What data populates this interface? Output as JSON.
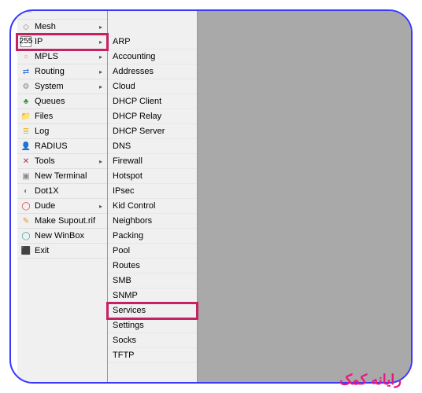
{
  "sidebar": {
    "items": [
      {
        "icon": "──",
        "iconClass": "c-gray",
        "label": "",
        "hasSub": false
      },
      {
        "icon": "◇",
        "iconClass": "c-gray",
        "label": "Mesh",
        "hasSub": true
      },
      {
        "icon": "255",
        "iconClass": "ip-box",
        "label": "IP",
        "hasSub": true,
        "highlight": true
      },
      {
        "icon": "○",
        "iconClass": "c-orange",
        "label": "MPLS",
        "hasSub": true
      },
      {
        "icon": "⇄",
        "iconClass": "c-blue",
        "label": "Routing",
        "hasSub": true
      },
      {
        "icon": "⚙",
        "iconClass": "c-gray",
        "label": "System",
        "hasSub": true
      },
      {
        "icon": "♣",
        "iconClass": "c-green",
        "label": "Queues",
        "hasSub": false
      },
      {
        "icon": "📁",
        "iconClass": "c-blue",
        "label": "Files",
        "hasSub": false
      },
      {
        "icon": "≣",
        "iconClass": "c-yellow",
        "label": "Log",
        "hasSub": false
      },
      {
        "icon": "👤",
        "iconClass": "c-green",
        "label": "RADIUS",
        "hasSub": false
      },
      {
        "icon": "✕",
        "iconClass": "c-crimson",
        "label": "Tools",
        "hasSub": true
      },
      {
        "icon": "▣",
        "iconClass": "c-gray",
        "label": "New Terminal",
        "hasSub": false
      },
      {
        "icon": "◐",
        "iconClass": "c-gray",
        "label": "Dot1X",
        "hasSub": false
      },
      {
        "icon": "◯",
        "iconClass": "c-red",
        "label": "Dude",
        "hasSub": true
      },
      {
        "icon": "✎",
        "iconClass": "c-orange",
        "label": "Make Supout.rif",
        "hasSub": false
      },
      {
        "icon": "◯",
        "iconClass": "c-teal",
        "label": "New WinBox",
        "hasSub": false
      },
      {
        "icon": "⬛",
        "iconClass": "c-brown",
        "label": "Exit",
        "hasSub": false
      }
    ]
  },
  "submenu": {
    "items": [
      {
        "label": "ARP"
      },
      {
        "label": "Accounting"
      },
      {
        "label": "Addresses"
      },
      {
        "label": "Cloud"
      },
      {
        "label": "DHCP Client"
      },
      {
        "label": "DHCP Relay"
      },
      {
        "label": "DHCP Server"
      },
      {
        "label": "DNS"
      },
      {
        "label": "Firewall"
      },
      {
        "label": "Hotspot"
      },
      {
        "label": "IPsec"
      },
      {
        "label": "Kid Control"
      },
      {
        "label": "Neighbors"
      },
      {
        "label": "Packing"
      },
      {
        "label": "Pool"
      },
      {
        "label": "Routes"
      },
      {
        "label": "SMB"
      },
      {
        "label": "SNMP"
      },
      {
        "label": "Services",
        "highlight": true
      },
      {
        "label": "Settings"
      },
      {
        "label": "Socks"
      },
      {
        "label": "TFTP"
      }
    ]
  },
  "brand": "رایانه کمک"
}
